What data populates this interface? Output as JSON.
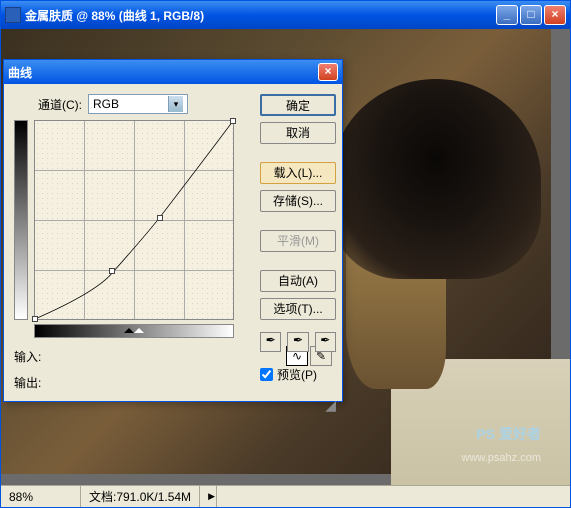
{
  "window": {
    "title": "金属肤质 @ 88% (曲线 1, RGB/8)",
    "min": "_",
    "max": "□",
    "close": "×"
  },
  "dialog": {
    "title": "曲线",
    "close": "×",
    "channel_label": "通道(C):",
    "channel_value": "RGB",
    "input_label": "输入:",
    "output_label": "输出:",
    "buttons": {
      "ok": "确定",
      "cancel": "取消",
      "load": "载入(L)...",
      "save": "存储(S)...",
      "smooth": "平滑(M)",
      "auto": "自动(A)",
      "options": "选项(T)..."
    },
    "preview_label": "预览(P)",
    "preview_checked": true,
    "curve_icon": "∿",
    "pencil_icon": "✎",
    "eyedrop_icon": "✒"
  },
  "chart_data": {
    "type": "line",
    "title": "",
    "xlabel": "输入",
    "ylabel": "输出",
    "xlim": [
      0,
      255
    ],
    "ylim": [
      0,
      255
    ],
    "series": [
      {
        "name": "RGB",
        "points": [
          [
            0,
            0
          ],
          [
            100,
            60
          ],
          [
            160,
            130
          ],
          [
            255,
            255
          ]
        ]
      }
    ]
  },
  "status": {
    "zoom": "88%",
    "doc": "文档:791.0K/1.54M"
  },
  "watermark": {
    "line1": "PS 爱好者",
    "line2": "www.psahz.com"
  }
}
